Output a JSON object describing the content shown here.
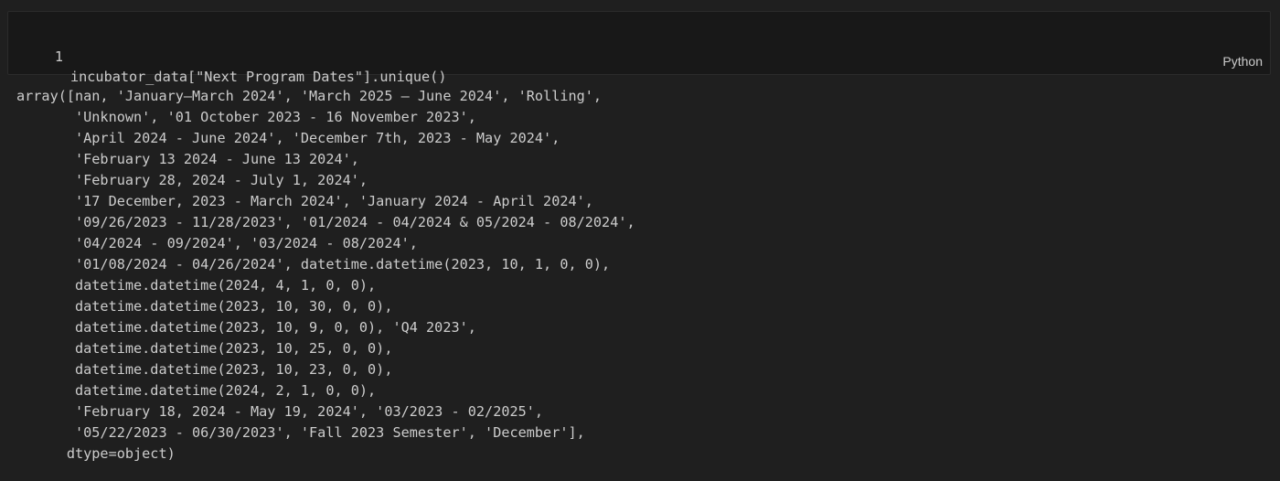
{
  "cell": {
    "line_number": "1",
    "code": "incubator_data[\"Next Program Dates\"].unique()",
    "language": "Python"
  },
  "output": {
    "lines": [
      "array([nan, 'January–March 2024', 'March 2025 – June 2024', 'Rolling',",
      "       'Unknown', '01 October 2023 - 16 November 2023',",
      "       'April 2024 - June 2024', 'December 7th, 2023 - May 2024',",
      "       'February 13 2024 - June 13 2024',",
      "       'February 28, 2024 - July 1, 2024',",
      "       '17 December, 2023 - March 2024', 'January 2024 - April 2024',",
      "       '09/26/2023 - 11/28/2023', '01/2024 - 04/2024 & 05/2024 - 08/2024',",
      "       '04/2024 - 09/2024', '03/2024 - 08/2024',",
      "       '01/08/2024 - 04/26/2024', datetime.datetime(2023, 10, 1, 0, 0),",
      "       datetime.datetime(2024, 4, 1, 0, 0),",
      "       datetime.datetime(2023, 10, 30, 0, 0),",
      "       datetime.datetime(2023, 10, 9, 0, 0), 'Q4 2023',",
      "       datetime.datetime(2023, 10, 25, 0, 0),",
      "       datetime.datetime(2023, 10, 23, 0, 0),",
      "       datetime.datetime(2024, 2, 1, 0, 0),",
      "       'February 18, 2024 - May 19, 2024', '03/2023 - 02/2025',",
      "       '05/22/2023 - 06/30/2023', 'Fall 2023 Semester', 'December'],",
      "      dtype=object)"
    ]
  }
}
